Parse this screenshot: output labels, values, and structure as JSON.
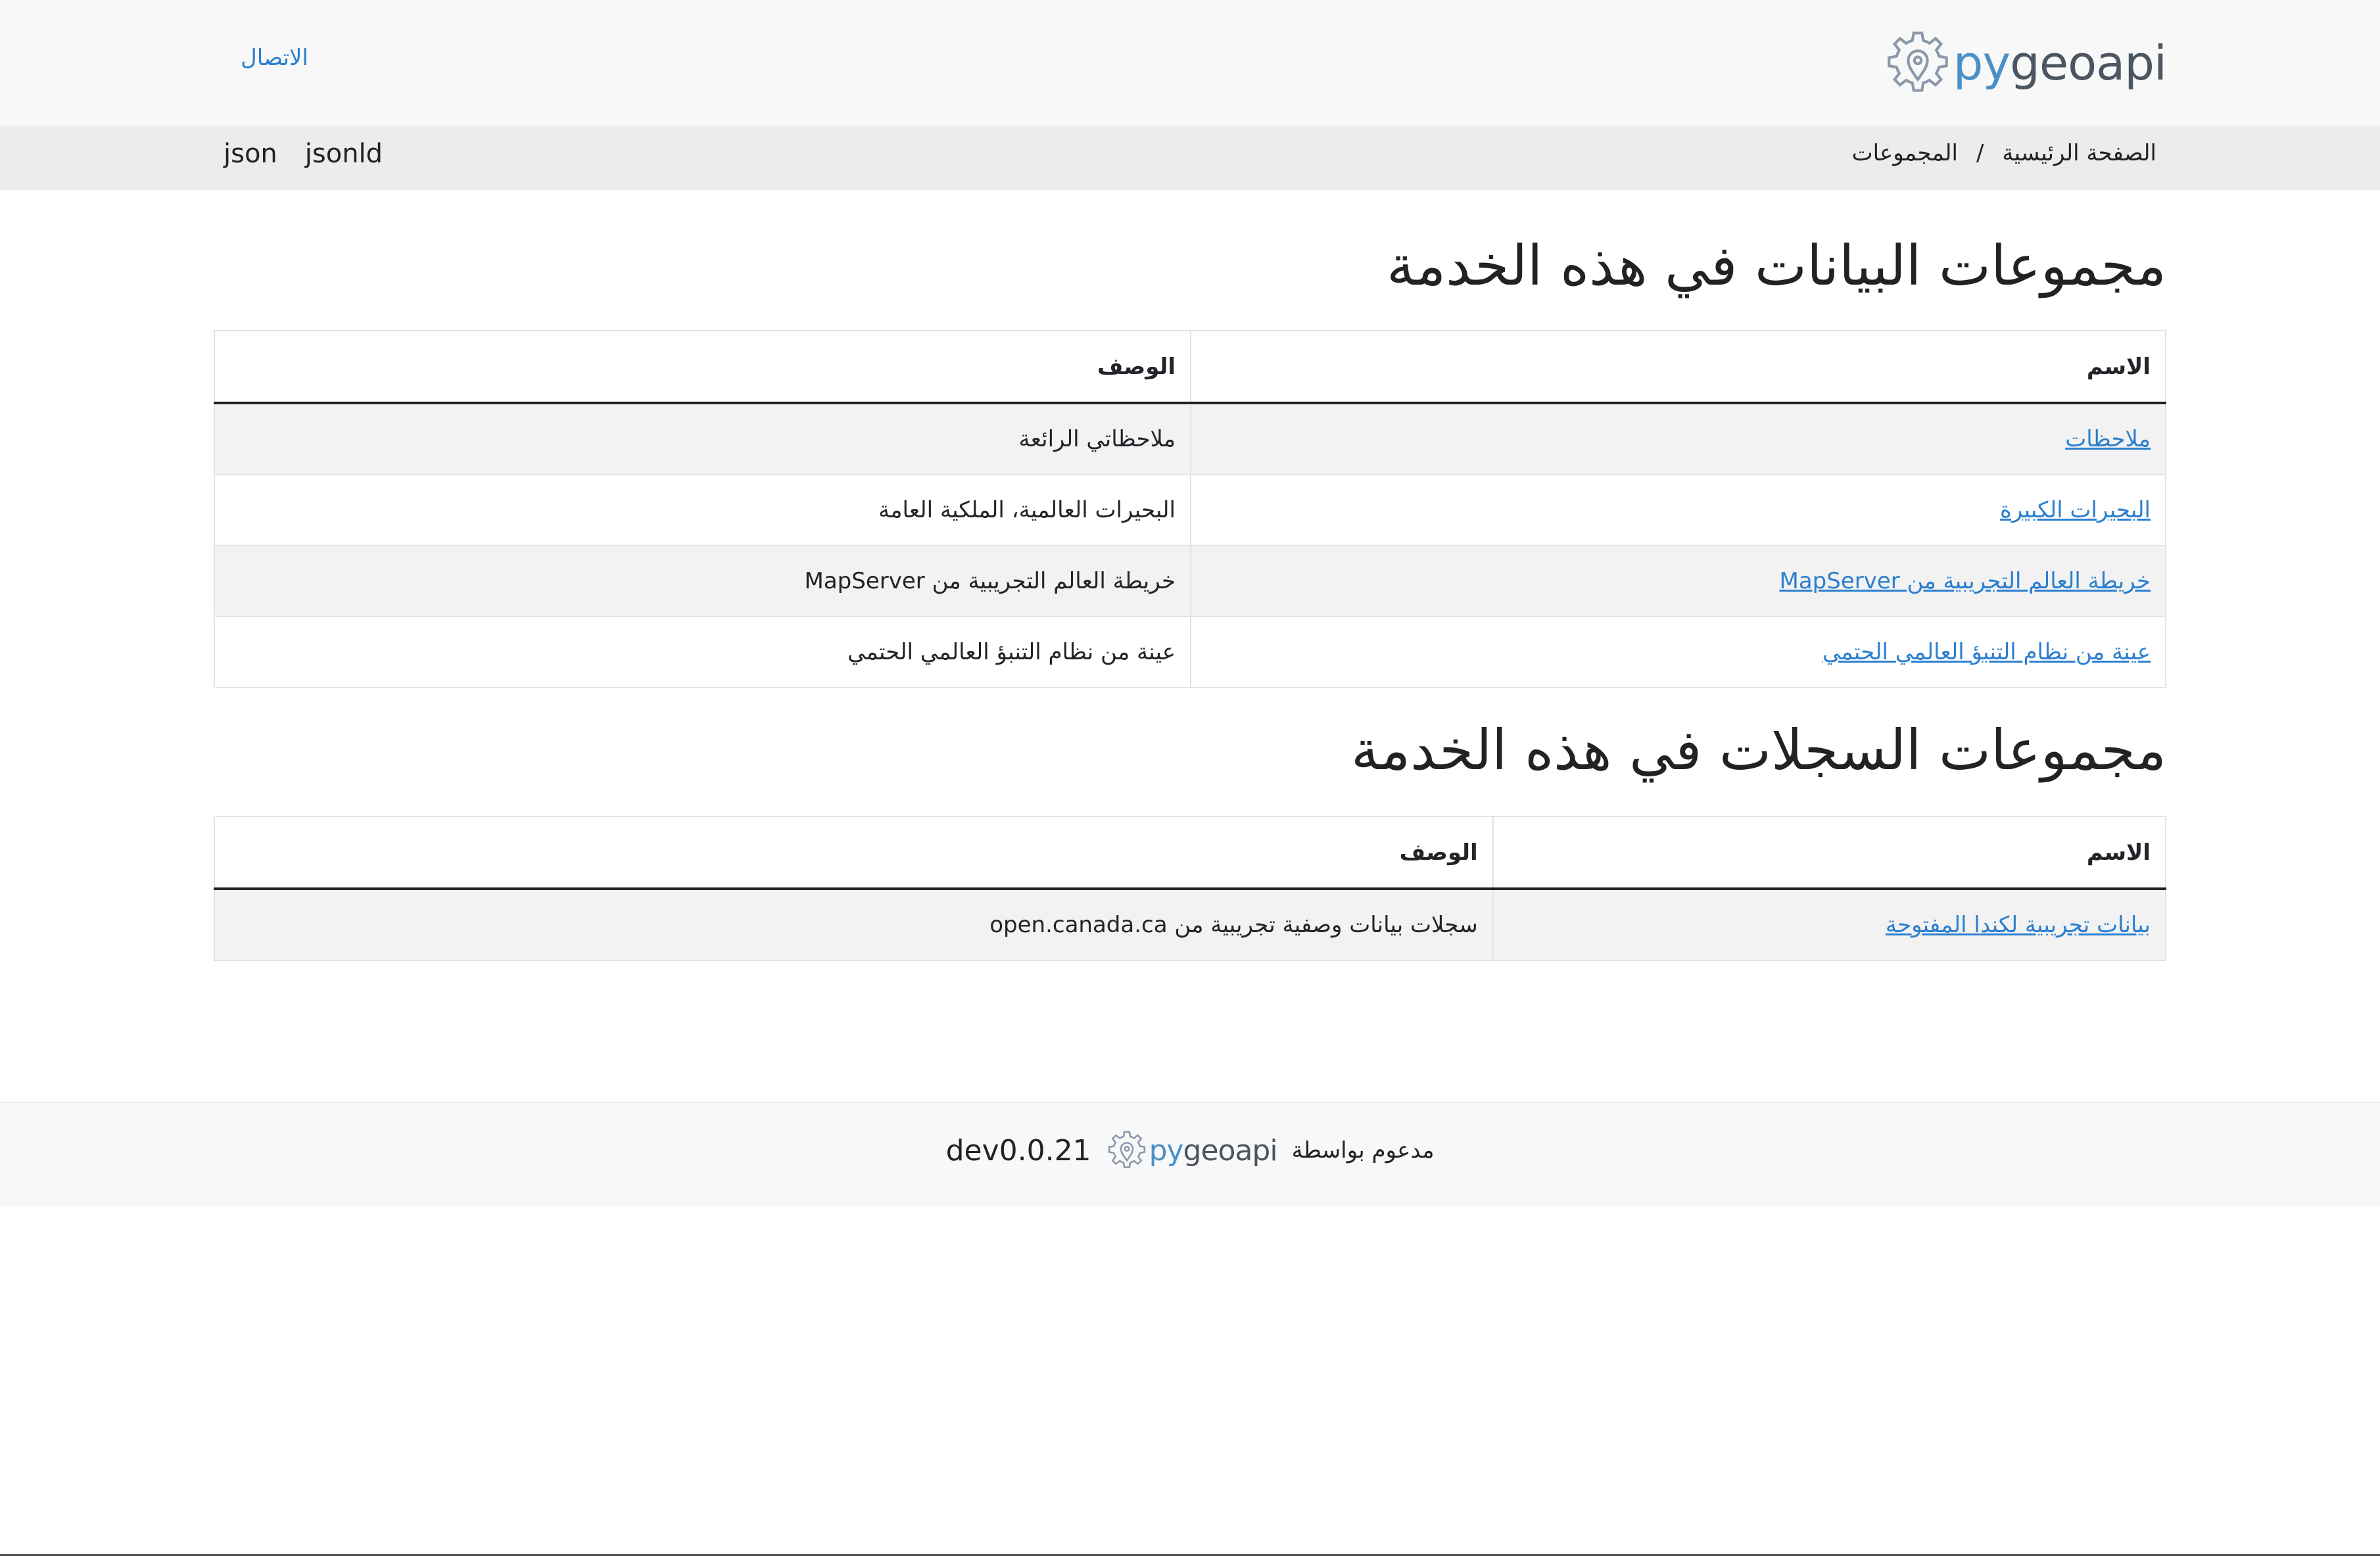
{
  "header": {
    "logo": {
      "prefix": "py",
      "rest": "geoapi",
      "icon": "gear-pin-icon"
    },
    "contact_label": "الاتصال"
  },
  "breadcrumb": {
    "home": "الصفحة الرئيسية",
    "separator": "/",
    "current": "المجموعات"
  },
  "formats": [
    "json",
    "jsonld"
  ],
  "datasets": {
    "title": "مجموعات البيانات في هذه الخدمة",
    "columns": {
      "name": "الاسم",
      "description": "الوصف"
    },
    "rows": [
      {
        "name": "ملاحظات",
        "description": "ملاحظاتي الرائعة"
      },
      {
        "name": "البحيرات الكبيرة",
        "description": "البحيرات العالمية، الملكية العامة"
      },
      {
        "name": "خريطة العالم التجريبية من MapServer",
        "description": "خريطة العالم التجريبية من MapServer"
      },
      {
        "name": "عينة من نظام التنبؤ العالمي الحتمي",
        "description": "عينة من نظام التنبؤ العالمي الحتمي"
      }
    ]
  },
  "records": {
    "title": "مجموعات السجلات في هذه الخدمة",
    "columns": {
      "name": "الاسم",
      "description": "الوصف"
    },
    "rows": [
      {
        "name": "بيانات تجريبية لكندا المفتوحة",
        "description": "سجلات بيانات وصفية تجريبية من open.canada.ca"
      }
    ]
  },
  "footer": {
    "powered_by": "مدعوم بواسطة",
    "logo": {
      "prefix": "py",
      "rest": "geoapi"
    },
    "version": "dev0.0.21"
  },
  "colors": {
    "link": "#2b7fcf",
    "logo_py": "#4a90c8",
    "logo_geo": "#4c5560"
  }
}
